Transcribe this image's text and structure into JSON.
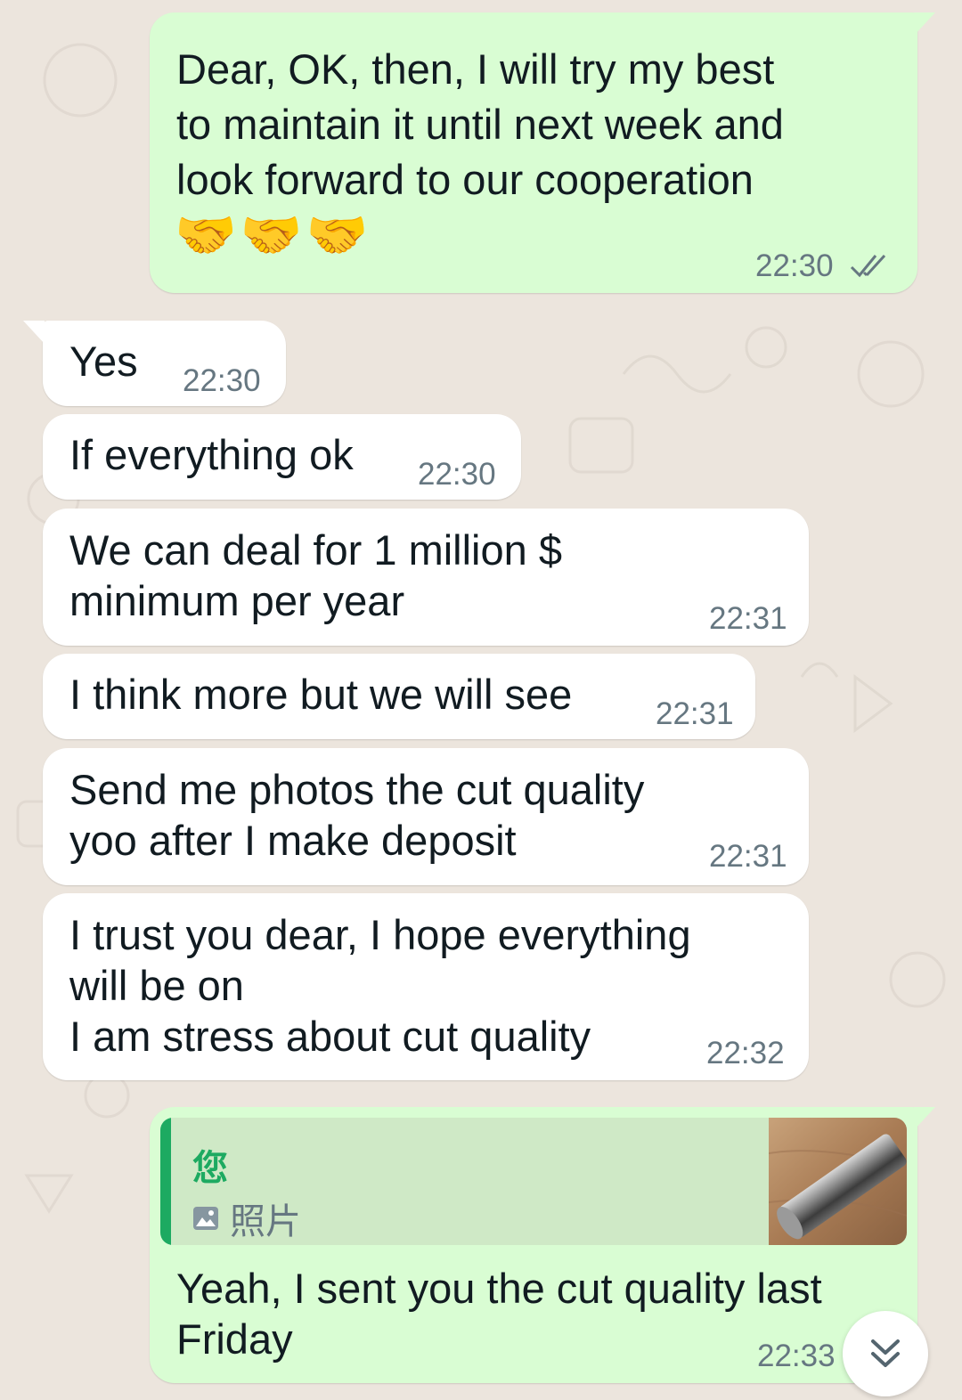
{
  "chat": {
    "messages": [
      {
        "direction": "outgoing",
        "text": "Dear,   OK, then, I will try my best\nto maintain it until next week and\nlook forward to our cooperation",
        "emoji": "🤝🤝🤝",
        "time": "22:30",
        "status_icon": "double-check-icon"
      },
      {
        "direction": "incoming",
        "text": "Yes",
        "time": "22:30"
      },
      {
        "direction": "incoming",
        "text": "If everything ok",
        "time": "22:30"
      },
      {
        "direction": "incoming",
        "text": "We can deal for 1 million $\nminimum per year",
        "time": "22:31"
      },
      {
        "direction": "incoming",
        "text": "I think more but we will see",
        "time": "22:31"
      },
      {
        "direction": "incoming",
        "text": "Send me photos the cut quality\nyoo after I make deposit",
        "time": "22:31"
      },
      {
        "direction": "incoming",
        "text": "I trust you dear, I hope everything\nwill be on\nI am stress about cut quality",
        "time": "22:32"
      },
      {
        "direction": "outgoing",
        "quote": {
          "author": "您",
          "kind_icon": "photo-icon",
          "kind": "照片"
        },
        "text": "Yeah, I sent you the cut quality last\nFriday",
        "time": "22:33"
      }
    ]
  },
  "scroll_button_icon": "double-chevron-down-icon",
  "colors": {
    "background": "#ece5dd",
    "outgoing_bubble": "#d9fdd3",
    "incoming_bubble": "#ffffff",
    "quote_accent": "#1daa61",
    "read_receipt": "#667781"
  }
}
